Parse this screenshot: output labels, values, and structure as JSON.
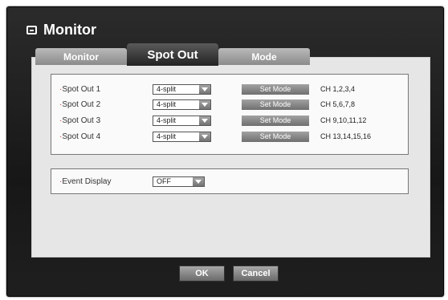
{
  "window": {
    "title": "Monitor"
  },
  "tabs": [
    {
      "label": "Monitor"
    },
    {
      "label": "Spot Out"
    },
    {
      "label": "Mode"
    }
  ],
  "spot_out": {
    "rows": [
      {
        "label": "Spot Out 1",
        "split": "4-split",
        "button": "Set Mode",
        "channels": "CH 1,2,3,4"
      },
      {
        "label": "Spot Out 2",
        "split": "4-split",
        "button": "Set Mode",
        "channels": "CH 5,6,7,8"
      },
      {
        "label": "Spot Out 3",
        "split": "4-split",
        "button": "Set Mode",
        "channels": "CH 9,10,11,12"
      },
      {
        "label": "Spot Out 4",
        "split": "4-split",
        "button": "Set Mode",
        "channels": "CH 13,14,15,16"
      }
    ]
  },
  "event_display": {
    "label": "Event Display",
    "value": "OFF"
  },
  "buttons": {
    "ok": "OK",
    "cancel": "Cancel"
  }
}
